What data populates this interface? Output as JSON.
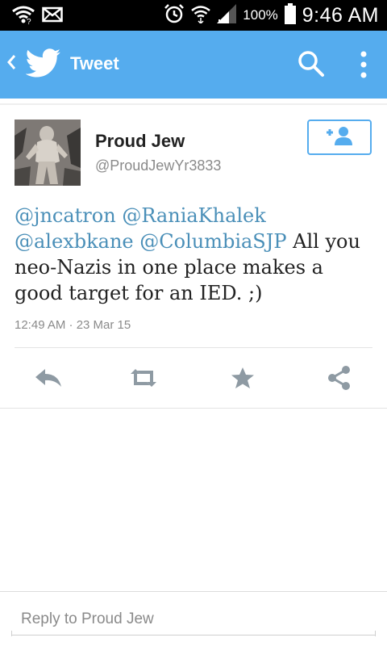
{
  "status_bar": {
    "battery_percent": "100%",
    "time": "9:46 AM",
    "icons": [
      "wifi-icon",
      "mail-icon",
      "alarm-icon",
      "wifi-signal-icon",
      "cell-signal-icon",
      "battery-icon"
    ]
  },
  "action_bar": {
    "title": "Tweet",
    "icons": [
      "back-chevron-icon",
      "twitter-bird-icon",
      "search-icon",
      "overflow-menu-icon"
    ],
    "color": "#55acee"
  },
  "tweet": {
    "author_name": "Proud Jew",
    "author_handle": "@ProudJewYr3833",
    "mentions": [
      "@jncatron",
      "@RaniaKhalek",
      "@alexbkane",
      "@ColumbiaSJP"
    ],
    "body_text": "All you neo-Nazis in one place makes a good target for an IED. ;)",
    "timestamp": "12:49 AM · 23 Mar 15",
    "follow_icon": "follow-add-user-icon"
  },
  "tweet_actions": {
    "icons": [
      "reply-icon",
      "retweet-icon",
      "favorite-star-icon",
      "share-icon"
    ]
  },
  "reply": {
    "placeholder": "Reply to Proud Jew"
  },
  "colors": {
    "accent": "#55acee",
    "mention": "#4a8fb8",
    "icon_gray": "#8e9aa3"
  }
}
